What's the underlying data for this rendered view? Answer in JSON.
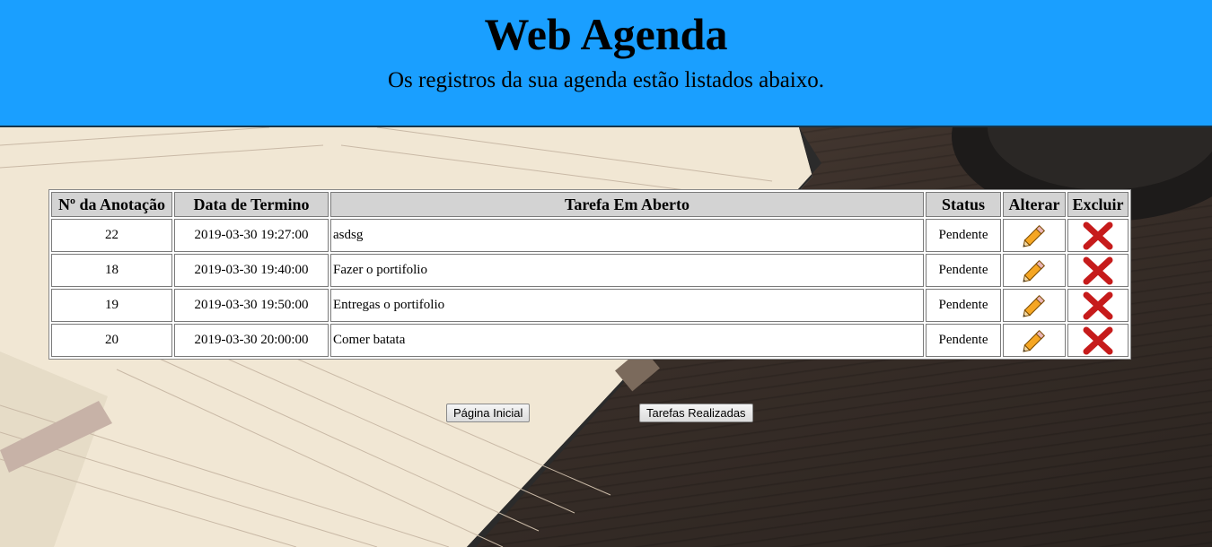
{
  "header": {
    "title": "Web Agenda",
    "subtitle": "Os registros da sua agenda estão listados abaixo.",
    "background_color": "#1a9fff"
  },
  "table": {
    "columns": [
      "Nº da Anotação",
      "Data de Termino",
      "Tarefa Em Aberto",
      "Status",
      "Alterar",
      "Excluir"
    ],
    "rows": [
      {
        "id": "22",
        "date": "2019-03-30 19:27:00",
        "task": "asdsg",
        "status": "Pendente",
        "edit_icon": "pencil-icon",
        "delete_icon": "red-x-icon"
      },
      {
        "id": "18",
        "date": "2019-03-30 19:40:00",
        "task": "Fazer o portifolio",
        "status": "Pendente",
        "edit_icon": "pencil-icon",
        "delete_icon": "red-x-icon"
      },
      {
        "id": "19",
        "date": "2019-03-30 19:50:00",
        "task": "Entregas o portifolio",
        "status": "Pendente",
        "edit_icon": "pencil-icon",
        "delete_icon": "red-x-icon"
      },
      {
        "id": "20",
        "date": "2019-03-30 20:00:00",
        "task": "Comer batata",
        "status": "Pendente",
        "edit_icon": "pencil-icon",
        "delete_icon": "red-x-icon"
      }
    ]
  },
  "buttons": {
    "home_label": "Página Inicial",
    "done_label": "Tarefas Realizadas"
  }
}
